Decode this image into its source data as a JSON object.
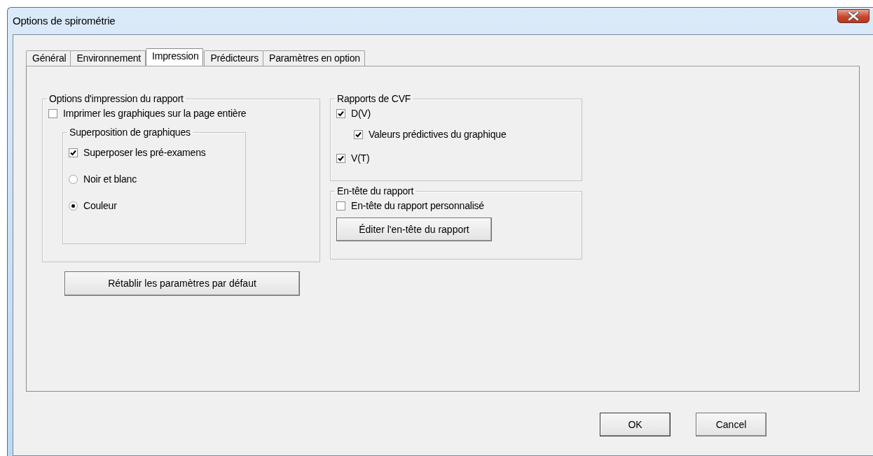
{
  "window": {
    "title": "Options de spirométrie"
  },
  "tabs": [
    {
      "label": "Général",
      "selected": false
    },
    {
      "label": "Environnement",
      "selected": false
    },
    {
      "label": "Impression",
      "selected": true
    },
    {
      "label": "Prédicteurs",
      "selected": false
    },
    {
      "label": "Paramètres en option",
      "selected": false
    }
  ],
  "print_options": {
    "title": "Options d'impression du rapport",
    "items": [
      {
        "kind": "checkbox",
        "label": "Imprimer les graphiques sur la page entière",
        "checked": false
      }
    ],
    "overlay": {
      "title": "Superposition de graphiques",
      "items": [
        {
          "kind": "checkbox",
          "label": "Superposer les pré-examens",
          "checked": true
        },
        {
          "kind": "radio",
          "label": "Noir et blanc",
          "selected": false
        },
        {
          "kind": "radio",
          "label": "Couleur",
          "selected": true
        }
      ]
    }
  },
  "reset_button": "Rétablir les paramètres par défaut",
  "fvc_reports": {
    "title": "Rapports de CVF",
    "items": [
      {
        "label": "D(V)",
        "checked": true,
        "children": [
          {
            "label": "Valeurs prédictives du graphique",
            "checked": true
          }
        ]
      },
      {
        "label": "V(T)",
        "checked": true
      }
    ]
  },
  "report_header": {
    "title": "En-tête du rapport",
    "checkbox": {
      "label": "En-tête du rapport personnalisé",
      "checked": false
    },
    "button": "Éditer l'en-tête du rapport"
  },
  "buttons": [
    "OK",
    "Cancel"
  ]
}
